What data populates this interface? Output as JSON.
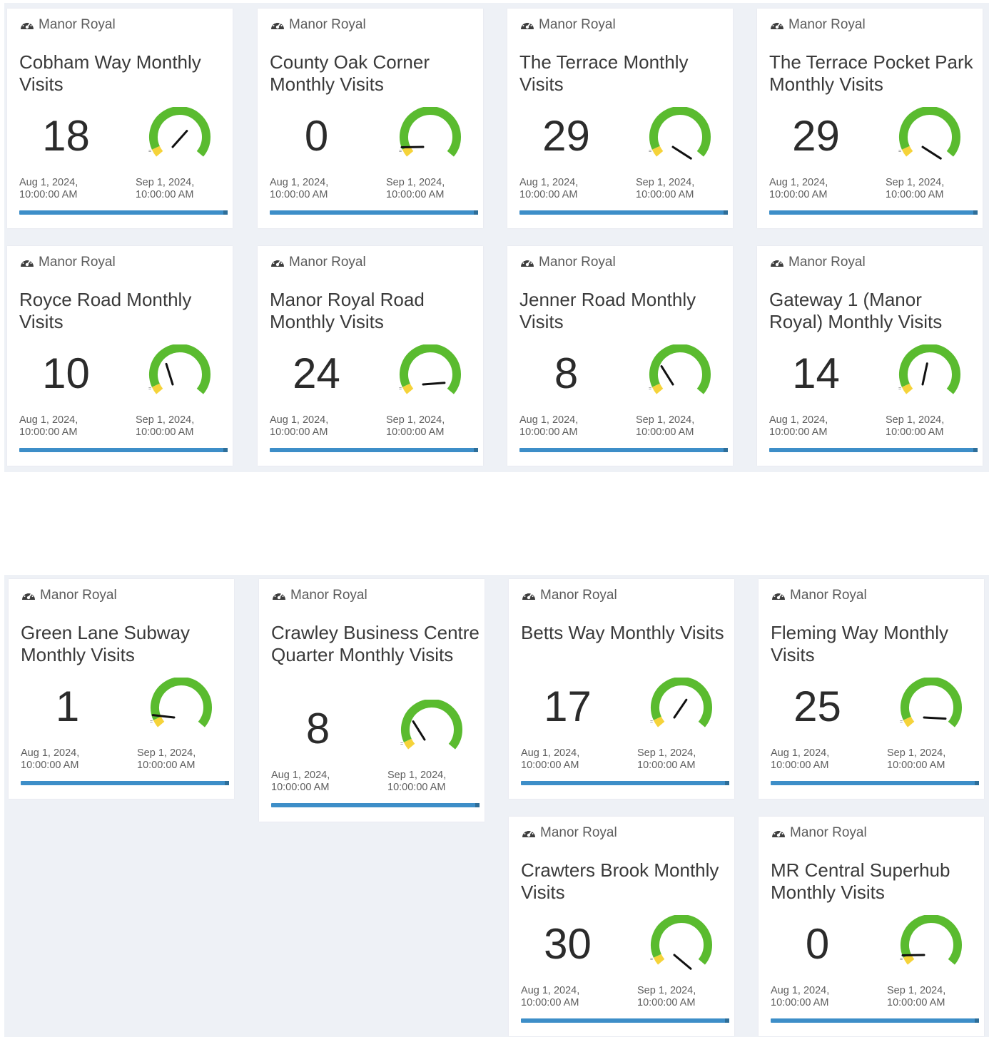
{
  "colors": {
    "gauge_green": "#5abb2f",
    "gauge_yellow": "#f5d33a",
    "needle": "#111111",
    "progress_bar": "#3d8ec8",
    "background": "#eef1f6"
  },
  "tiles": [
    {
      "source": "Manor Royal",
      "title": "Cobham Way Monthly Visits",
      "value": "18",
      "gauge_value": 18,
      "start": "Aug 1, 2024,\n10:00:00 AM",
      "end": "Sep 1, 2024,\n10:00:00 AM",
      "icon": "dashboard-gauge-icon"
    },
    {
      "source": "Manor Royal",
      "title": "County Oak Corner Monthly Visits",
      "value": "0",
      "gauge_value": 0,
      "start": "Aug 1, 2024,\n10:00:00 AM",
      "end": "Sep 1, 2024,\n10:00:00 AM",
      "icon": "dashboard-gauge-icon"
    },
    {
      "source": "Manor Royal",
      "title": "The Terrace Monthly Visits",
      "value": "29",
      "gauge_value": 29,
      "start": "Aug 1, 2024,\n10:00:00 AM",
      "end": "Sep 1, 2024,\n10:00:00 AM",
      "icon": "dashboard-gauge-icon"
    },
    {
      "source": "Manor Royal",
      "title": "The Terrace Pocket Park Monthly Visits",
      "value": "29",
      "gauge_value": 29,
      "start": "Aug 1, 2024,\n10:00:00 AM",
      "end": "Sep 1, 2024,\n10:00:00 AM",
      "icon": "dashboard-gauge-icon"
    },
    {
      "source": "Manor Royal",
      "title": "Royce Road Monthly Visits",
      "value": "10",
      "gauge_value": 10,
      "start": "Aug 1, 2024,\n10:00:00 AM",
      "end": "Sep 1, 2024,\n10:00:00 AM",
      "icon": "dashboard-gauge-icon"
    },
    {
      "source": "Manor Royal",
      "title": "Manor Royal Road Monthly Visits",
      "value": "24",
      "gauge_value": 24,
      "start": "Aug 1, 2024,\n10:00:00 AM",
      "end": "Sep 1, 2024,\n10:00:00 AM",
      "icon": "dashboard-gauge-icon"
    },
    {
      "source": "Manor Royal",
      "title": "Jenner Road Monthly Visits",
      "value": "8",
      "gauge_value": 8,
      "start": "Aug 1, 2024,\n10:00:00 AM",
      "end": "Sep 1, 2024,\n10:00:00 AM",
      "icon": "dashboard-gauge-icon"
    },
    {
      "source": "Manor Royal",
      "title": "Gateway 1 (Manor Royal) Monthly Visits",
      "value": "14",
      "gauge_value": 14,
      "start": "Aug 1, 2024,\n10:00:00 AM",
      "end": "Sep 1, 2024,\n10:00:00 AM",
      "icon": "dashboard-gauge-icon"
    },
    {
      "source": "Manor Royal",
      "title": "Green Lane Subway Monthly Visits",
      "value": "1",
      "gauge_value": 1,
      "start": "Aug 1, 2024,\n10:00:00 AM",
      "end": "Sep 1, 2024,\n10:00:00 AM",
      "icon": "dashboard-gauge-icon"
    },
    {
      "source": "Manor Royal",
      "title": "Crawley Business Centre Quarter Monthly Visits",
      "value": "8",
      "gauge_value": 8,
      "start": "Aug 1, 2024,\n10:00:00 AM",
      "end": "Sep 1, 2024,\n10:00:00 AM",
      "icon": "dashboard-gauge-icon"
    },
    {
      "source": "Manor Royal",
      "title": "Betts Way Monthly Visits",
      "value": "17",
      "gauge_value": 17,
      "start": "Aug 1, 2024,\n10:00:00 AM",
      "end": "Sep 1, 2024,\n10:00:00 AM",
      "icon": "dashboard-gauge-icon"
    },
    {
      "source": "Manor Royal",
      "title": "Fleming Way Monthly Visits",
      "value": "25",
      "gauge_value": 25,
      "start": "Aug 1, 2024,\n10:00:00 AM",
      "end": "Sep 1, 2024,\n10:00:00 AM",
      "icon": "dashboard-gauge-icon"
    },
    {
      "source": "Manor Royal",
      "title": "Crawters Brook Monthly Visits",
      "value": "30",
      "gauge_value": 30,
      "start": "Aug 1, 2024,\n10:00:00 AM",
      "end": "Sep 1, 2024,\n10:00:00 AM",
      "icon": "dashboard-gauge-icon"
    },
    {
      "source": "Manor Royal",
      "title": "MR Central Superhub Monthly Visits",
      "value": "0",
      "gauge_value": 0,
      "start": "Aug 1, 2024,\n10:00:00 AM",
      "end": "Sep 1, 2024,\n10:00:00 AM",
      "icon": "dashboard-gauge-icon"
    }
  ]
}
